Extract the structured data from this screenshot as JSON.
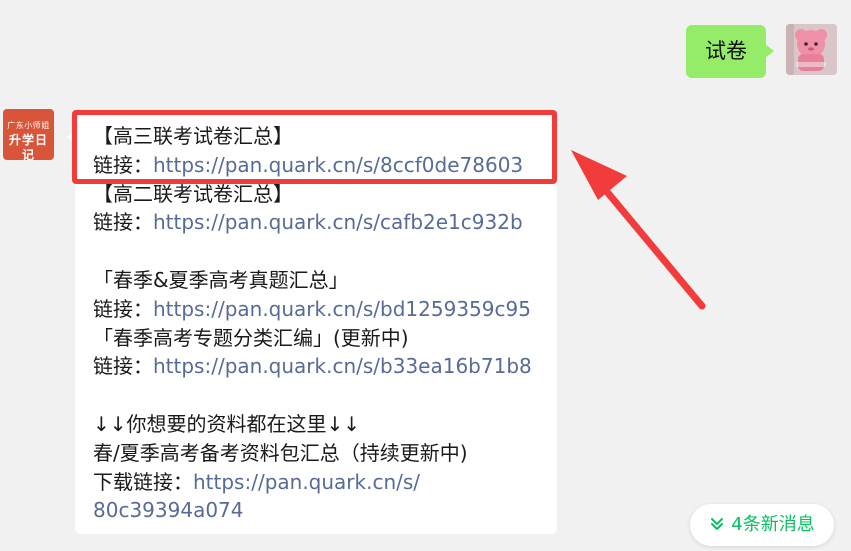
{
  "outgoing": {
    "text": "试卷"
  },
  "incoming": {
    "avatar": {
      "line1": "广东小师姐",
      "line2": "升学日记"
    },
    "lines": [
      {
        "text": "【高三联考试卷汇总】"
      },
      {
        "label": "链接：",
        "link": "https://pan.quark.cn/s/8ccf0de78603"
      },
      {
        "text": "【高二联考试卷汇总】"
      },
      {
        "label": "链接：",
        "link": "https://pan.quark.cn/s/cafb2e1c932b"
      },
      {
        "text": "「春季&夏季高考真题汇总」"
      },
      {
        "label": "链接：",
        "link": "https://pan.quark.cn/s/bd1259359c95"
      },
      {
        "text": "「春季高考专题分类汇编」(更新中)"
      },
      {
        "label": "链接：",
        "link": "https://pan.quark.cn/s/b33ea16b71b8"
      },
      {
        "text": "↓↓你想要的资料都在这里↓↓"
      },
      {
        "text": "春/夏季高考备考资料包汇总（持续更新中)"
      },
      {
        "label": "下载链接：",
        "link": "https://pan.quark.cn/s/"
      },
      {
        "link": "80c39394a074"
      }
    ]
  },
  "new_messages": {
    "label": "4条新消息",
    "icon": "double-chevron-down-icon"
  },
  "colors": {
    "background": "#f1f1f1",
    "bubble_out": "#95ec69",
    "bubble_in": "#ffffff",
    "link": "#576b95",
    "annotation": "#f23b3b",
    "accent_green": "#07c160",
    "avatar_in": "#d8553a"
  }
}
